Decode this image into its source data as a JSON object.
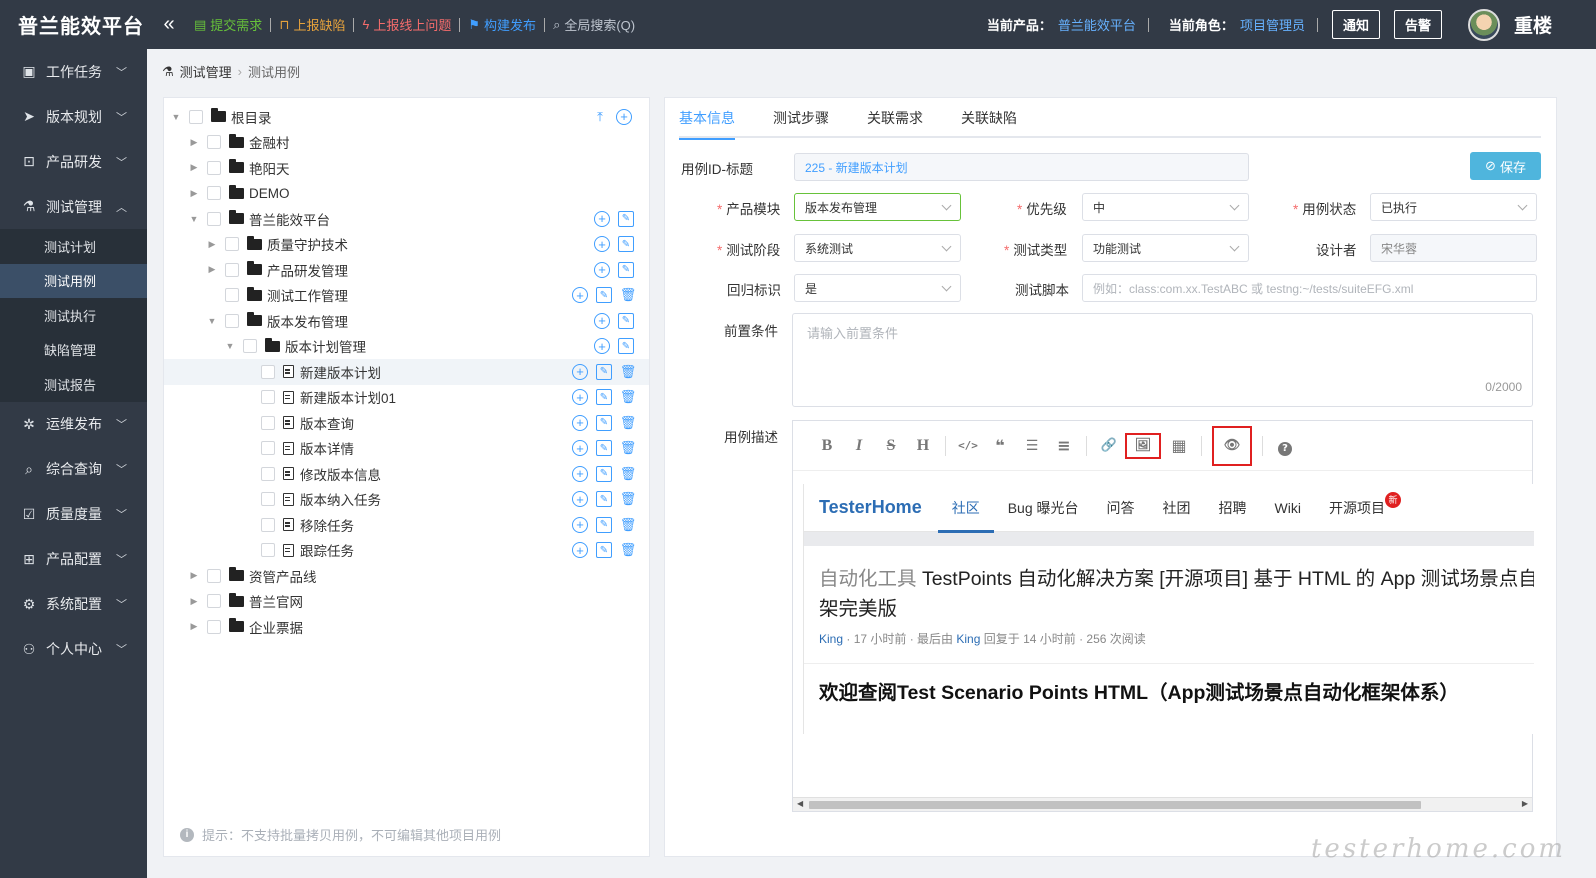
{
  "header": {
    "brand": "普兰能效平台",
    "collapse_icon": "«",
    "quick_links": [
      {
        "label": "提交需求",
        "color": "#67c23a"
      },
      {
        "label": "上报缺陷",
        "color": "#e6a23c"
      },
      {
        "label": "上报线上问题",
        "color": "#f56c6c"
      },
      {
        "label": "构建发布",
        "color": "#409eff"
      },
      {
        "label": "全局搜索(Q)",
        "color": "#bfc6d0"
      }
    ],
    "product_label": "当前产品：",
    "product_value": "普兰能效平台",
    "role_label": "当前角色：",
    "role_value": "项目管理员",
    "notice_button": "通知",
    "alarm_button": "告警",
    "username": "重楼"
  },
  "sidebar": {
    "items": [
      {
        "label": "工作任务",
        "icon": "calendar-icon"
      },
      {
        "label": "版本规划",
        "icon": "send-icon"
      },
      {
        "label": "产品研发",
        "icon": "code-icon"
      },
      {
        "label": "测试管理",
        "icon": "flask-icon",
        "expanded": true
      },
      {
        "label": "运维发布",
        "icon": "gear-icon"
      },
      {
        "label": "综合查询",
        "icon": "search-icon"
      },
      {
        "label": "质量度量",
        "icon": "checklist-icon"
      },
      {
        "label": "产品配置",
        "icon": "grid-icon"
      },
      {
        "label": "系统配置",
        "icon": "settings-icon"
      },
      {
        "label": "个人中心",
        "icon": "user-icon"
      }
    ],
    "sub_items": [
      "测试计划",
      "测试用例",
      "测试执行",
      "缺陷管理",
      "测试报告"
    ],
    "active_sub": "测试用例"
  },
  "breadcrumb": {
    "first": "测试管理",
    "second": "测试用例"
  },
  "tree": {
    "rows": [
      {
        "label": "根目录",
        "type": "folder",
        "level": 0,
        "expand": "open"
      },
      {
        "label": "金融村",
        "type": "folder",
        "level": 1,
        "expand": "closed"
      },
      {
        "label": "艳阳天",
        "type": "folder",
        "level": 1,
        "expand": "closed"
      },
      {
        "label": "DEMO",
        "type": "folder",
        "level": 1,
        "expand": "closed"
      },
      {
        "label": "普兰能效平台",
        "type": "folder",
        "level": 1,
        "expand": "open"
      },
      {
        "label": "质量守护技术",
        "type": "folder",
        "level": 2,
        "expand": "closed"
      },
      {
        "label": "产品研发管理",
        "type": "folder",
        "level": 2,
        "expand": "closed"
      },
      {
        "label": "测试工作管理",
        "type": "folder",
        "level": 2,
        "expand": "none"
      },
      {
        "label": "版本发布管理",
        "type": "folder",
        "level": 2,
        "expand": "open"
      },
      {
        "label": "版本计划管理",
        "type": "folder",
        "level": 3,
        "expand": "open"
      },
      {
        "label": "新建版本计划",
        "type": "file",
        "level": 4,
        "expand": "none"
      },
      {
        "label": "新建版本计划01",
        "type": "file",
        "level": 4,
        "expand": "none"
      },
      {
        "label": "版本查询",
        "type": "file",
        "level": 4,
        "expand": "none"
      },
      {
        "label": "版本详情",
        "type": "file",
        "level": 4,
        "expand": "none"
      },
      {
        "label": "修改版本信息",
        "type": "file",
        "level": 4,
        "expand": "none"
      },
      {
        "label": "版本纳入任务",
        "type": "file",
        "level": 4,
        "expand": "none"
      },
      {
        "label": "移除任务",
        "type": "file",
        "level": 4,
        "expand": "none"
      },
      {
        "label": "跟踪任务",
        "type": "file",
        "level": 4,
        "expand": "none"
      },
      {
        "label": "资管产品线",
        "type": "folder",
        "level": 1,
        "expand": "closed"
      },
      {
        "label": "普兰官网",
        "type": "folder",
        "level": 1,
        "expand": "closed"
      },
      {
        "label": "企业票据",
        "type": "folder",
        "level": 1,
        "expand": "closed"
      }
    ],
    "selected": "新建版本计划",
    "tip": "提示：不支持批量拷贝用例，不可编辑其他项目用例"
  },
  "tabs": [
    "基本信息",
    "测试步骤",
    "关联需求",
    "关联缺陷"
  ],
  "active_tab": "基本信息",
  "form": {
    "id_title_label": "用例ID-标题",
    "id_title_value": "225 - 新建版本计划",
    "save_button": "保存",
    "module_label": "产品模块",
    "module_value": "版本发布管理",
    "priority_label": "优先级",
    "priority_value": "中",
    "status_label": "用例状态",
    "status_value": "已执行",
    "stage_label": "测试阶段",
    "stage_value": "系统测试",
    "type_label": "测试类型",
    "type_value": "功能测试",
    "designer_label": "设计者",
    "designer_value": "宋华蓉",
    "regression_label": "回归标识",
    "regression_value": "是",
    "script_label": "测试脚本",
    "script_placeholder": "例如：class:com.xx.TestABC 或 testng:~/tests/suiteEFG.xml",
    "precondition_label": "前置条件",
    "precondition_placeholder": "请输入前置条件",
    "precondition_count": "0/2000",
    "description_label": "用例描述"
  },
  "editor": {
    "toolbar": [
      {
        "name": "bold-button",
        "glyph": "B"
      },
      {
        "name": "italic-button",
        "glyph": "I"
      },
      {
        "name": "strike-button",
        "glyph": "S"
      },
      {
        "name": "heading-button",
        "glyph": "H"
      },
      {
        "name": "code-button",
        "glyph": "</>"
      },
      {
        "name": "quote-button",
        "glyph": "❝"
      },
      {
        "name": "ul-button",
        "glyph": "☰"
      },
      {
        "name": "ol-button",
        "glyph": "≡"
      },
      {
        "name": "link-button",
        "glyph": "🔗"
      },
      {
        "name": "image-button",
        "glyph": "🖼"
      },
      {
        "name": "table-button",
        "glyph": "▦"
      },
      {
        "name": "preview-button",
        "glyph": "👁"
      },
      {
        "name": "help-button",
        "glyph": "?"
      }
    ],
    "preview": {
      "brand": "TesterHome",
      "nav": [
        "社区",
        "Bug 曝光台",
        "问答",
        "社团",
        "招聘",
        "Wiki",
        "开源项目"
      ],
      "active_nav": "社区",
      "new_badge": "新",
      "title_category": "自动化工具",
      "title_text": "TestPoints 自动化解决方案 [开源项目] 基于 HTML 的 App 测试场景点自动化框",
      "title_cont": "架完美版",
      "meta_user": "King",
      "meta_time": " · 17 小时前 · 最后由 ",
      "meta_user2": "King",
      "meta_tail": " 回复于 14 小时前 · 256 次阅读",
      "heading": "欢迎查阅Test Scenario Points HTML（App测试场景点自动化框架体系）"
    }
  },
  "watermark": "testerhome.com"
}
